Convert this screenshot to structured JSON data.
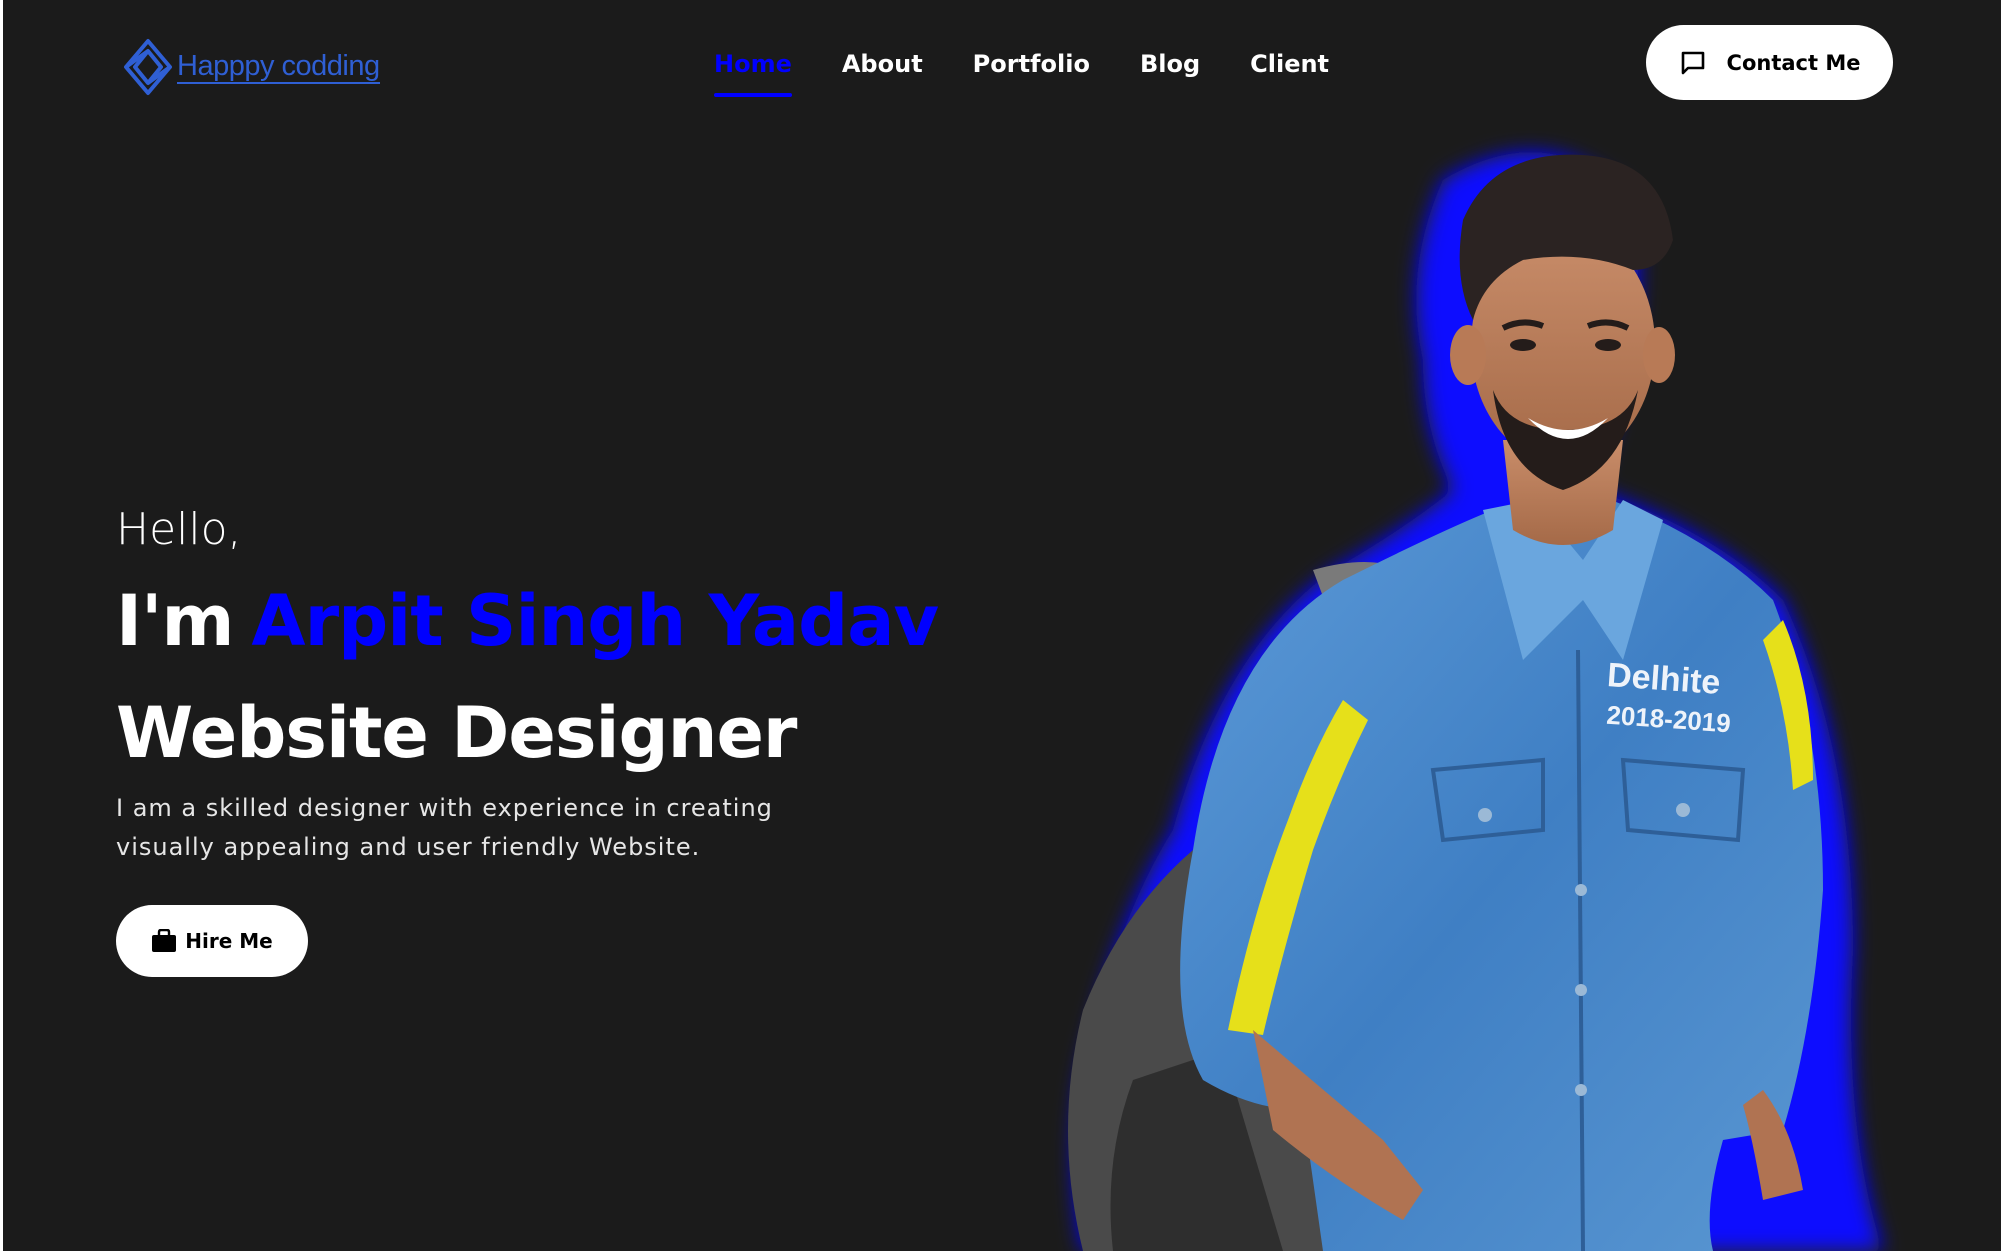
{
  "brand": {
    "logo_text": "Happpy codding",
    "logo_icon": "diamond-logo-icon",
    "logo_color": "#2f5fd4"
  },
  "nav": {
    "items": [
      {
        "label": "Home",
        "active": true
      },
      {
        "label": "About",
        "active": false
      },
      {
        "label": "Portfolio",
        "active": false
      },
      {
        "label": "Blog",
        "active": false
      },
      {
        "label": "Client",
        "active": false
      }
    ]
  },
  "contact_button": {
    "label": "Contact Me",
    "icon": "chat-bubble-icon"
  },
  "hero": {
    "greeting": "Hello,",
    "intro": "I'm",
    "name": "Arpit Singh Yadav",
    "role": "Website Designer",
    "description": "I am a skilled designer with experience in creating visually appealing and user friendly Website.",
    "hire_button": {
      "label": "Hire Me",
      "icon": "briefcase-icon"
    }
  },
  "portrait": {
    "jacket_print_line1": "Delhite",
    "jacket_print_line2": "2018-2019"
  },
  "colors": {
    "background": "#1b1b1b",
    "accent": "#0000ff",
    "text": "#ffffff",
    "button_bg": "#ffffff",
    "button_text": "#000000"
  }
}
